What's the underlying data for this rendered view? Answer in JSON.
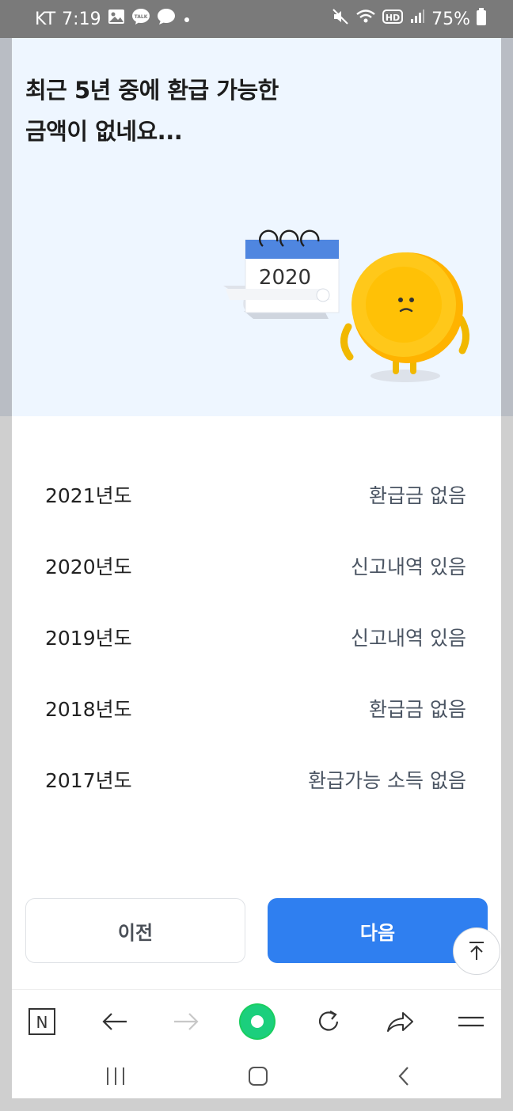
{
  "status_bar": {
    "carrier": "KT",
    "time": "7:19",
    "hd_label": "HD",
    "battery_percent": "75%",
    "icons": [
      "image-icon",
      "talk-icon",
      "chat-bubble-icon",
      "dot-icon",
      "mute-icon",
      "wifi-icon",
      "hd-icon",
      "signal-icon",
      "battery-icon"
    ]
  },
  "header": {
    "title": "최근 5년 중에 환급 가능한\n금액이 없네요..."
  },
  "illustration": {
    "calendar_year": "2020",
    "colors": {
      "calendar_top": "#4f86e0",
      "coin": "#ffc107",
      "hero_bg": "#eef6ff"
    }
  },
  "refund_list": [
    {
      "year": "2021년도",
      "status": "환급금 없음"
    },
    {
      "year": "2020년도",
      "status": "신고내역 있음"
    },
    {
      "year": "2019년도",
      "status": "신고내역 있음"
    },
    {
      "year": "2018년도",
      "status": "환급금 없음"
    },
    {
      "year": "2017년도",
      "status": "환급가능 소득 없음"
    }
  ],
  "buttons": {
    "prev_label": "이전",
    "next_label": "다음",
    "accent": "#2f7ff0"
  },
  "browser_toolbar": {
    "icons": [
      "naver-n-icon",
      "back-arrow-icon",
      "forward-arrow-icon",
      "home-green-icon",
      "refresh-icon",
      "share-icon",
      "menu-icon"
    ],
    "home_color": "#19ce60",
    "naver_letter": "N"
  },
  "system_nav": {
    "icons": [
      "recent-apps-icon",
      "home-icon",
      "back-icon"
    ]
  }
}
